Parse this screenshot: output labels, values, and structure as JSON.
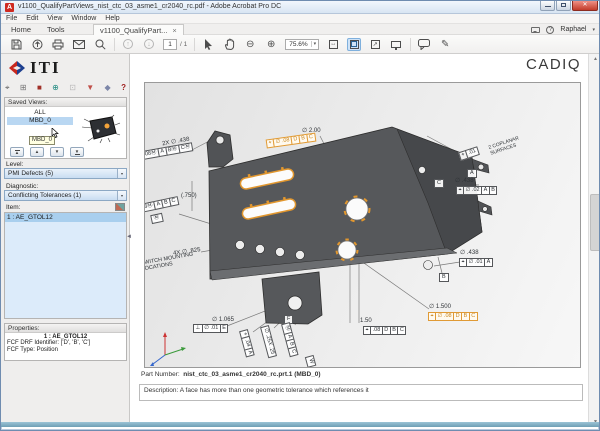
{
  "window": {
    "title": "v1100_QualifyPartViews_nist_ctc_03_asme1_cr2040_rc.pdf - Adobe Acrobat Pro DC",
    "app_initial": "A",
    "close_glyph": "✕",
    "menu": [
      "File",
      "Edit",
      "View",
      "Window",
      "Help"
    ]
  },
  "tabs": {
    "home": "Home",
    "tools": "Tools",
    "doc": "v1100_QualifyPart...",
    "close": "×"
  },
  "account": {
    "name": "Raphael",
    "caret": "▾",
    "help": "?"
  },
  "toolbar": {
    "page_current": "1",
    "page_total": "/ 1",
    "zoom": "75.6%",
    "caret": "▾",
    "prev": "↑",
    "next": "↓",
    "zoom_out": "⊖",
    "zoom_in": "⊕",
    "fit_width": "↔",
    "fullscreen": "↗",
    "pencil": "✎"
  },
  "sidebar": {
    "logo_text": "ITI",
    "icons": {
      "pan": "⌖",
      "views": "⊞",
      "model": "■",
      "axes": "⊕",
      "compare": "⊡",
      "filter": "▼",
      "report": "◆",
      "help": "?"
    },
    "saved_views_title": "Saved Views:",
    "views": [
      "ALL",
      "MBD_0"
    ],
    "tooltip": "MBD_0",
    "nav": {
      "up": "▲",
      "down": "▼"
    },
    "level_label": "Level:",
    "level_value": "PMI Defects (5)",
    "diagnostic_label": "Diagnostic:",
    "diagnostic_value": "Conflicting Tolerances (1)",
    "item_label": "Item:",
    "items": [
      "1 : AE_GTOL12"
    ],
    "properties_title": "Properties:",
    "prop_heading": "1 : AE_GTOL12",
    "prop_line1": "FCF DRF Identifier: ['D', 'B', 'C']",
    "prop_line2": "FCF Type: Position"
  },
  "main": {
    "brand": "CADIQ",
    "part_number_label": "Part Number:",
    "part_number_value": "nist_ctc_03_asme1_cr2040_rc.prt.1 (MBD_0)",
    "description": "Description: A face has more than one geometric tolerance which references it"
  },
  "viewport": {
    "ann_2x438": {
      "dim": "2X ∅ .438",
      "cells": [
        "∅.08Ⓜ",
        "A",
        "BⓂ",
        "CⓂ"
      ]
    },
    "ann_200": {
      "dim": "∅ 2.00",
      "cells": [
        "⌖",
        "∅ .08",
        "D",
        "B",
        "C"
      ]
    },
    "ann_coplanar": {
      "cells": [
        "⌖",
        ".01"
      ],
      "note1": "2 COPLANAR",
      "note2": "SURFACES",
      "datum": "A"
    },
    "ann_438c": {
      "datum": "C",
      "dim": "∅ .438",
      "cells": [
        "⌖",
        "∅ .02",
        "A",
        "B"
      ]
    },
    "ann_438a": {
      "dim": "∅ .438",
      "cells": [
        "⌖",
        "∅ .01",
        "A"
      ]
    },
    "datum_b": "B",
    "ann_1500": {
      "dim": "∅ 1.500",
      "cells": [
        "⌖",
        "∅ .08",
        "D",
        "B",
        "C"
      ]
    },
    "ann_150": {
      "dim": "1.50",
      "cells": [
        "⌖",
        ".08",
        "D",
        "B",
        "C"
      ]
    },
    "ann_1065": {
      "dim": "∅ 1.065",
      "cells": [
        "⊥",
        "∅ .01",
        "E"
      ]
    },
    "datum_f": "F",
    "ann_825": {
      "dim": "4X ∅ .825",
      "note1": "SWITCH MOUNTING",
      "note2": "LOCATIONS"
    },
    "ann_left": {
      "cells": [
        "⌖",
        ".08Ⓜ",
        "A",
        "B",
        "C"
      ],
      "datum": "Ⓜ"
    },
    "ann_750": "(.750)",
    "strip1": {
      "cells": [
        "⌖",
        ".04",
        "A"
      ]
    },
    "strip2": {
      "text": "∅ .25X .25"
    },
    "strip3": {
      "cells": [
        "Ⓜ",
        "A",
        "B",
        "C"
      ],
      "datum": "W"
    }
  }
}
